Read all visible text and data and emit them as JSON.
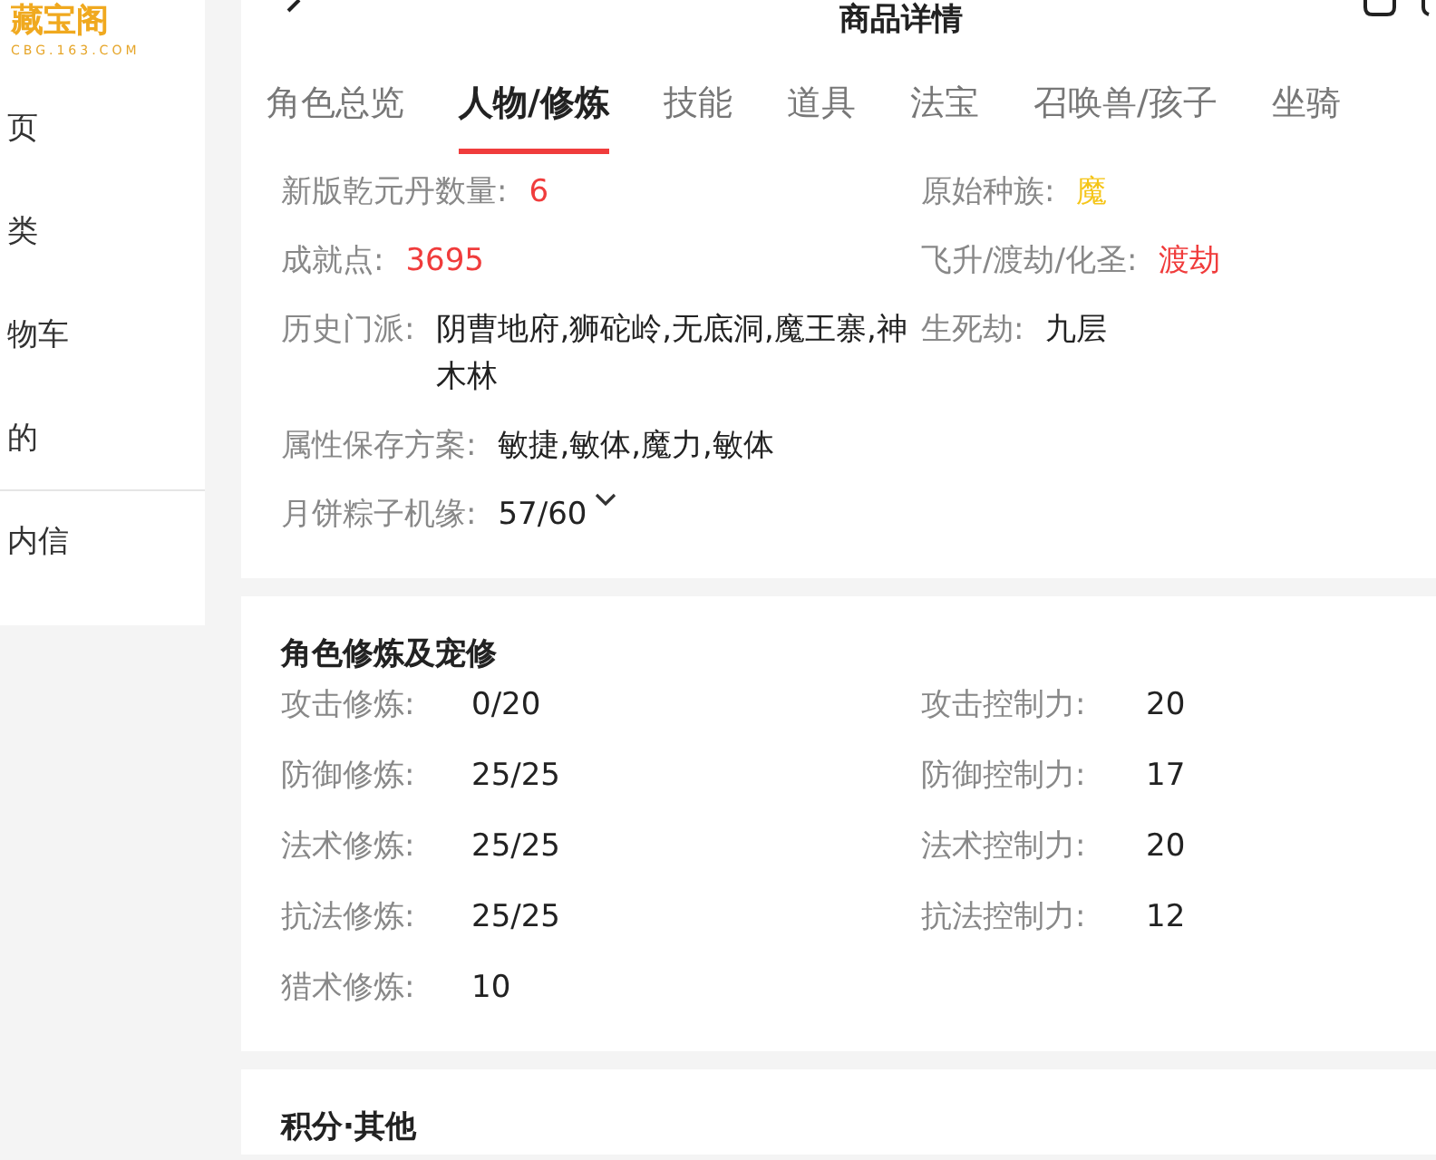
{
  "sidebar": {
    "logo": {
      "name": "藏宝阁",
      "domain": "CBG.163.COM"
    },
    "items": [
      {
        "label": "页",
        "divider_before": false
      },
      {
        "label": "类",
        "divider_before": false
      },
      {
        "label": "物车",
        "divider_before": false
      },
      {
        "label": "的",
        "divider_before": false
      },
      {
        "label": "内信",
        "divider_before": true
      }
    ]
  },
  "header": {
    "title": "商品详情"
  },
  "tabs": [
    {
      "label": "角色总览",
      "selected": false
    },
    {
      "label": "人物/修炼",
      "selected": true
    },
    {
      "label": "技能",
      "selected": false
    },
    {
      "label": "道具",
      "selected": false
    },
    {
      "label": "法宝",
      "selected": false
    },
    {
      "label": "召唤兽/孩子",
      "selected": false
    },
    {
      "label": "坐骑",
      "selected": false
    }
  ],
  "info": {
    "left": [
      {
        "label": "新版乾元丹数量:",
        "value": "6",
        "color": "#f03c3c"
      },
      {
        "label": "成就点:",
        "value": "3695",
        "color": "#f03c3c"
      },
      {
        "label": "历史门派:",
        "value": "阴曹地府,狮砣岭,无底洞,魔王寨,神木林",
        "color": "#222222"
      },
      {
        "label": "属性保存方案:",
        "value": "敏捷,敏体,魔力,敏体",
        "color": "#222222"
      },
      {
        "label": "月饼粽子机缘:",
        "value": "57/60",
        "color": "#222222",
        "expandable": true
      }
    ],
    "right": [
      {
        "label": "原始种族:",
        "value": "魔",
        "color": "#f5c518"
      },
      {
        "label": "飞升/渡劫/化圣:",
        "value": "渡劫",
        "color": "#f03c3c"
      },
      {
        "label": "生死劫:",
        "value": "九层",
        "color": "#222222"
      }
    ]
  },
  "cultivation": {
    "title": "角色修炼及宠修",
    "rows": [
      {
        "label": "攻击修炼:",
        "value": "0/20"
      },
      {
        "label": "攻击控制力:",
        "value": "20"
      },
      {
        "label": "防御修炼:",
        "value": "25/25"
      },
      {
        "label": "防御控制力:",
        "value": "17"
      },
      {
        "label": "法术修炼:",
        "value": "25/25"
      },
      {
        "label": "法术控制力:",
        "value": "20"
      },
      {
        "label": "抗法修炼:",
        "value": "25/25"
      },
      {
        "label": "抗法控制力:",
        "value": "12"
      },
      {
        "label": "猎术修炼:",
        "value": "10"
      }
    ]
  },
  "next_section": {
    "title": "积分·其他"
  }
}
